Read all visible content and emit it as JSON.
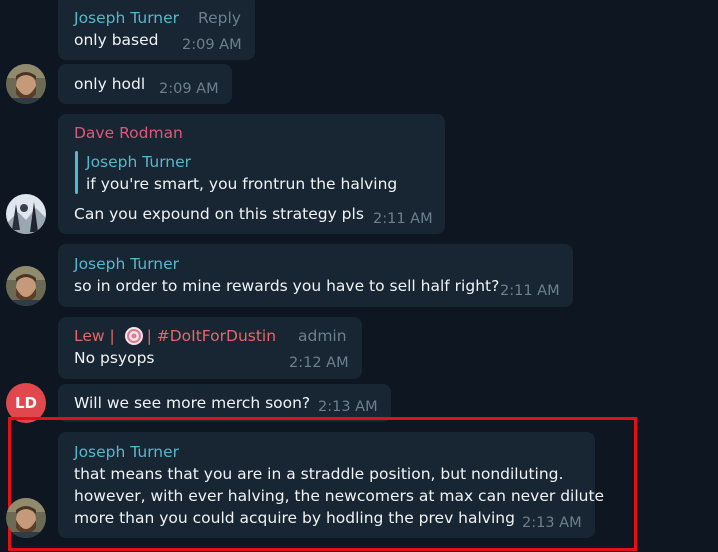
{
  "colors": {
    "background": "#0e1621",
    "bubble": "#182533",
    "name_teal": "#56b8ce",
    "name_pink": "#e0577c",
    "name_red": "#e56866",
    "timestamp": "#6d7f8f",
    "highlight_box": "#e3101a",
    "avatar_ld": "#e0484e"
  },
  "messages": [
    {
      "sender": "Joseph Turner",
      "sender_extra": "Reply",
      "text": "only based",
      "time": "2:09 AM"
    },
    {
      "text": "only hodl",
      "time": "2:09 AM",
      "avatar": "bearded-man-avatar"
    },
    {
      "sender": "Dave Rodman",
      "quote": {
        "author": "Joseph Turner",
        "text": "if you're smart, you frontrun the halving"
      },
      "text": "Can you expound on  this strategy pls",
      "time": "2:11 AM",
      "avatar": "snow-photo-avatar"
    },
    {
      "sender": "Joseph Turner",
      "text": "so in order to mine rewards you have to sell half right?",
      "time": "2:11 AM",
      "avatar": "bearded-man-avatar"
    },
    {
      "sender_prefix": "Lew | ",
      "sender_suffix": " | #DoItForDustin",
      "sender_badge_icon": "candy-emoji-icon",
      "role": "admin",
      "text": "No psyops",
      "time": "2:12 AM"
    },
    {
      "text": "Will we see more merch soon?",
      "time": "2:13 AM",
      "avatar_initials": "LD"
    },
    {
      "sender": "Joseph Turner",
      "lines": [
        "that means that you are in a straddle position, but nondiluting.",
        "however, with ever halving, the newcomers at max can never dilute",
        "more than you could acquire by hodling the prev halving"
      ],
      "time": "2:13 AM",
      "avatar": "bearded-man-avatar",
      "highlighted": true
    }
  ]
}
